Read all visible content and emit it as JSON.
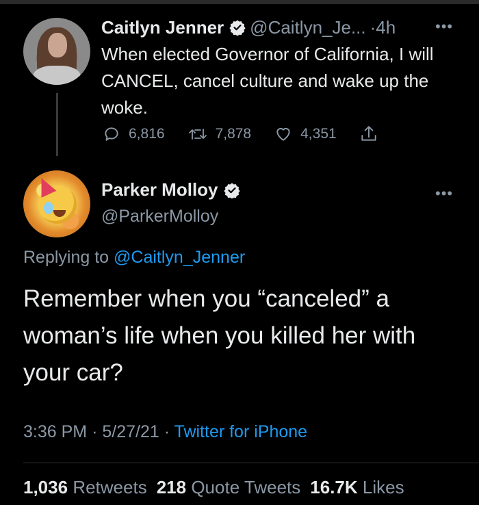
{
  "parent_tweet": {
    "author_name": "Caitlyn Jenner",
    "author_handle": "@Caitlyn_Je...",
    "time": "·4h",
    "text": "When elected Governor of California, I will CANCEL, cancel culture and wake up the woke.",
    "replies": "6,816",
    "retweets": "7,878",
    "likes": "4,351"
  },
  "reply_tweet": {
    "author_name": "Parker Molloy",
    "author_handle": "@ParkerMolloy",
    "replying_label": "Replying to",
    "replying_handle": "@Caitlyn_Jenner",
    "text": "Remember when you “canceled” a woman’s life when you killed her with your car?",
    "time": "3:36 PM",
    "date": "5/27/21",
    "source": "Twitter for iPhone",
    "retweets_count": "1,036",
    "retweets_label": "Retweets",
    "quotes_count": "218",
    "quotes_label": "Quote Tweets",
    "likes_count": "16.7K",
    "likes_label": "Likes"
  },
  "icons": {
    "more": "more-icon",
    "verified": "verified-badge-icon",
    "reply": "reply-icon",
    "retweet": "retweet-icon",
    "like": "heart-icon",
    "share": "share-icon"
  },
  "colors": {
    "background": "#000000",
    "text": "#e7e9ea",
    "muted": "#8b98a5",
    "link": "#1d9bf0"
  }
}
